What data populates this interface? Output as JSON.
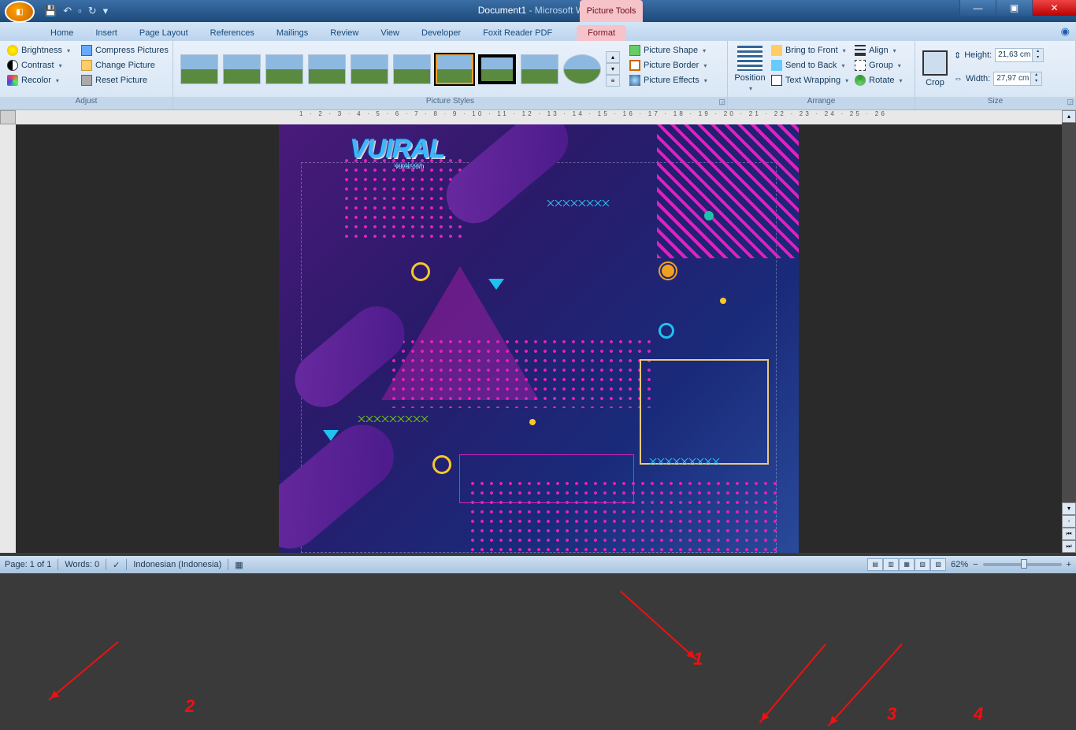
{
  "title": {
    "doc": "Document1",
    "app": " - Microsoft Word",
    "contextual": "Picture Tools"
  },
  "tabs": [
    "Home",
    "Insert",
    "Page Layout",
    "References",
    "Mailings",
    "Review",
    "View",
    "Developer",
    "Foxit Reader PDF",
    "Format"
  ],
  "ribbon": {
    "adjust": {
      "caption": "Adjust",
      "brightness": "Brightness",
      "contrast": "Contrast",
      "recolor": "Recolor",
      "compress": "Compress Pictures",
      "change": "Change Picture",
      "reset": "Reset Picture"
    },
    "styles": {
      "caption": "Picture Styles",
      "shape": "Picture Shape",
      "border": "Picture Border",
      "effects": "Picture Effects"
    },
    "arrange": {
      "caption": "Arrange",
      "position": "Position",
      "front": "Bring to Front",
      "back": "Send to Back",
      "wrap": "Text Wrapping",
      "align": "Align",
      "group": "Group",
      "rotate": "Rotate"
    },
    "size": {
      "caption": "Size",
      "crop": "Crop",
      "height_label": "Height:",
      "height_val": "21,63 cm",
      "width_label": "Width:",
      "width_val": "27,97 cm"
    }
  },
  "ruler_marks": "1 · 2 · 3 · 4 · 5 · 6 · 7 · 8 · 9 · 10 · 11 · 12 · 13 · 14 · 15 · 16 · 17 · 18 · 19 · 20 · 21 · 22 · 23 · 24 · 25 · 26",
  "watermark": {
    "main": "VUIRAL",
    "sub": "vuiral.com"
  },
  "status": {
    "page": "Page: 1 of 1",
    "words": "Words: 0",
    "lang": "Indonesian (Indonesia)",
    "zoom": "62%"
  },
  "annotations": {
    "n1": "1",
    "n2": "2",
    "n3": "3",
    "n4": "4"
  }
}
